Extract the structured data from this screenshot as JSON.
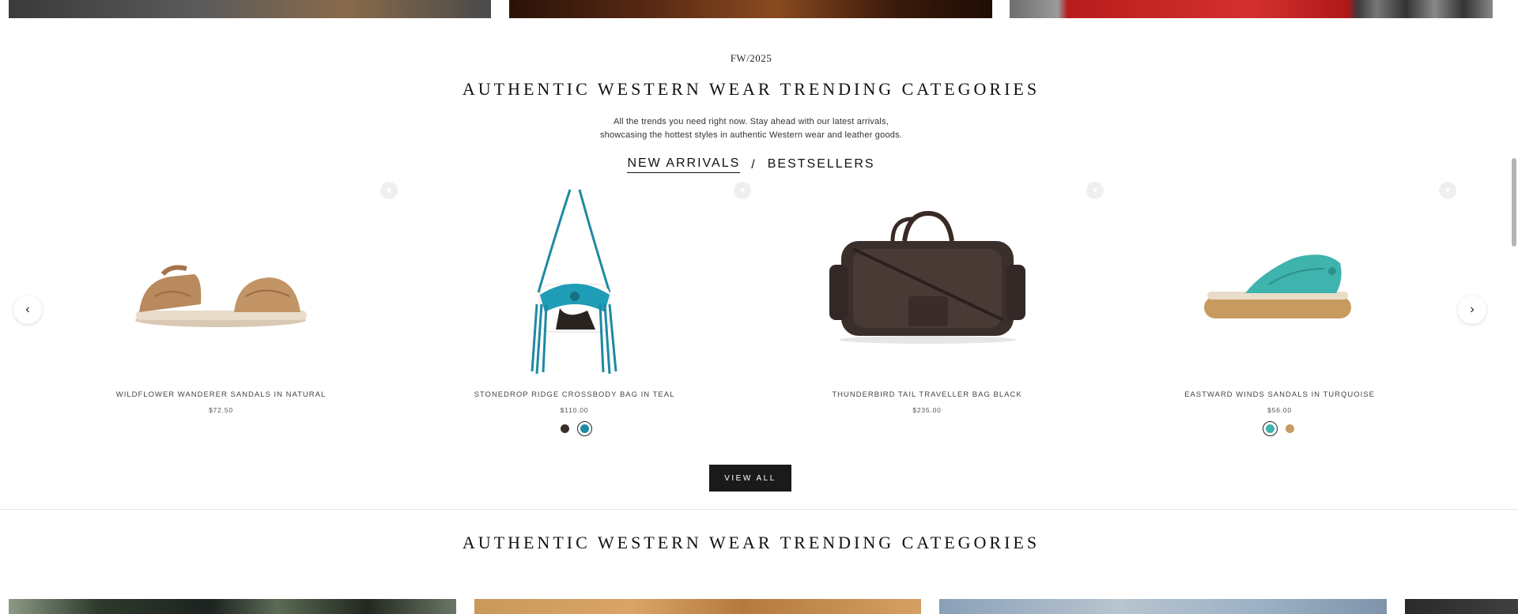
{
  "section": {
    "season": "FW/2025",
    "title": "AUTHENTIC WESTERN WEAR TRENDING CATEGORIES",
    "description_line1": "All the trends you need right now. Stay ahead with our latest arrivals,",
    "description_line2": "showcasing the hottest styles in authentic Western wear and leather goods.",
    "tabs": [
      {
        "label": "NEW ARRIVALS",
        "active": true
      },
      {
        "label": "BESTSELLERS",
        "active": false
      }
    ],
    "separator": "/",
    "view_all_label": "VIEW ALL"
  },
  "products": [
    {
      "name": "WILDFLOWER WANDERER SANDALS IN NATURAL",
      "price": "$72.50",
      "icon": "sandal-natural"
    },
    {
      "name": "STONEDROP RIDGE CROSSBODY BAG IN TEAL",
      "price": "$110.00",
      "icon": "crossbody-bag-teal",
      "swatches": [
        {
          "color": "#3a2e28",
          "selected": false
        },
        {
          "color": "#1d8aa3",
          "selected": true
        }
      ]
    },
    {
      "name": "THUNDERBIRD TAIL TRAVELLER BAG BLACK",
      "price": "$235.00",
      "icon": "duffel-bag-black"
    },
    {
      "name": "EASTWARD WINDS SANDALS IN TURQUOISE",
      "price": "$56.00",
      "icon": "sandal-turquoise",
      "swatches": [
        {
          "color": "#3fb3ad",
          "selected": true
        },
        {
          "color": "#c79b5e",
          "selected": false
        }
      ]
    }
  ],
  "bottom_section": {
    "title": "AUTHENTIC WESTERN WEAR TRENDING CATEGORIES"
  },
  "colors": {
    "button_bg": "#1a1a1a",
    "teal": "#1d8aa3"
  }
}
